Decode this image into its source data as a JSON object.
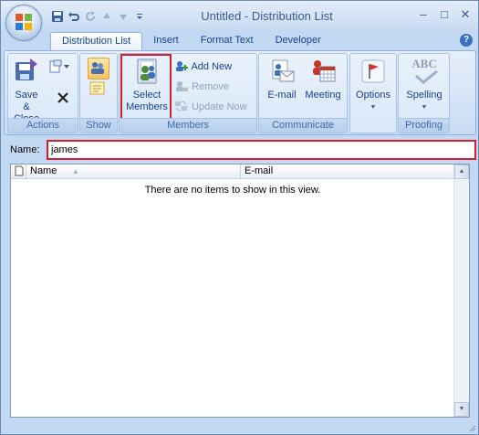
{
  "window": {
    "title": "Untitled  -  Distribution List",
    "controls": {
      "minimize": "–",
      "maximize": "□",
      "close": "✕"
    }
  },
  "qat": {
    "items": [
      "save-icon",
      "undo-icon",
      "redo-icon",
      "up-arrow-icon",
      "down-arrow-icon",
      "customize-dropdown-icon"
    ]
  },
  "tabs": [
    {
      "label": "Distribution List",
      "active": true
    },
    {
      "label": "Insert",
      "active": false
    },
    {
      "label": "Format Text",
      "active": false
    },
    {
      "label": "Developer",
      "active": false
    }
  ],
  "help": "?",
  "ribbon": {
    "groups": {
      "actions": {
        "label": "Actions",
        "save_close": "Save &\nClose",
        "save_close_l1": "Save &",
        "save_close_l2": "Close"
      },
      "show": {
        "label": "Show"
      },
      "members": {
        "label": "Members",
        "select_l1": "Select",
        "select_l2": "Members",
        "add_new": "Add New",
        "remove": "Remove",
        "update_now": "Update Now"
      },
      "communicate": {
        "label": "Communicate",
        "email": "E-mail",
        "meeting": "Meeting"
      },
      "options": {
        "label": "Options"
      },
      "proofing": {
        "label": "Proofing",
        "spelling": "Spelling",
        "abc": "ABC"
      }
    }
  },
  "form": {
    "name_label": "Name:",
    "name_value": "james"
  },
  "list": {
    "columns": [
      "Name",
      "E-mail"
    ],
    "empty_message": "There are no items to show in this view."
  },
  "colors": {
    "accent_red": "#d21f2b",
    "ribbon_blue": "#c3d9f3",
    "text_blue": "#15428b"
  }
}
